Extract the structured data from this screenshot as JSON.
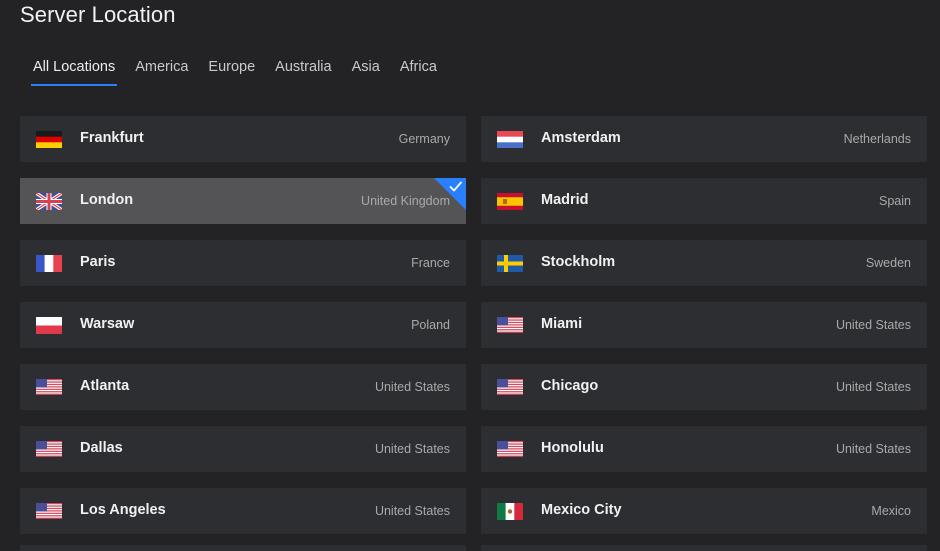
{
  "title": "Server Location",
  "tabs": [
    "All Locations",
    "America",
    "Europe",
    "Australia",
    "Asia",
    "Africa"
  ],
  "active_tab": "All Locations",
  "colors": {
    "accent": "#2a7fff",
    "row_bg": "#2d2e32",
    "selected_bg": "#545457",
    "page_bg": "#232326"
  },
  "locations_left": [
    {
      "city": "Frankfurt",
      "country": "Germany",
      "flag": "germany-flag"
    },
    {
      "city": "London",
      "country": "United Kingdom",
      "flag": "uk-flag",
      "selected": true
    },
    {
      "city": "Paris",
      "country": "France",
      "flag": "france-flag"
    },
    {
      "city": "Warsaw",
      "country": "Poland",
      "flag": "poland-flag"
    },
    {
      "city": "Atlanta",
      "country": "United States",
      "flag": "usa-flag"
    },
    {
      "city": "Dallas",
      "country": "United States",
      "flag": "usa-flag"
    },
    {
      "city": "Los Angeles",
      "country": "United States",
      "flag": "usa-flag"
    }
  ],
  "locations_right": [
    {
      "city": "Amsterdam",
      "country": "Netherlands",
      "flag": "netherlands-flag"
    },
    {
      "city": "Madrid",
      "country": "Spain",
      "flag": "spain-flag"
    },
    {
      "city": "Stockholm",
      "country": "Sweden",
      "flag": "sweden-flag"
    },
    {
      "city": "Miami",
      "country": "United States",
      "flag": "usa-flag"
    },
    {
      "city": "Chicago",
      "country": "United States",
      "flag": "usa-flag"
    },
    {
      "city": "Honolulu",
      "country": "United States",
      "flag": "usa-flag"
    },
    {
      "city": "Mexico City",
      "country": "Mexico",
      "flag": "mexico-flag"
    }
  ]
}
